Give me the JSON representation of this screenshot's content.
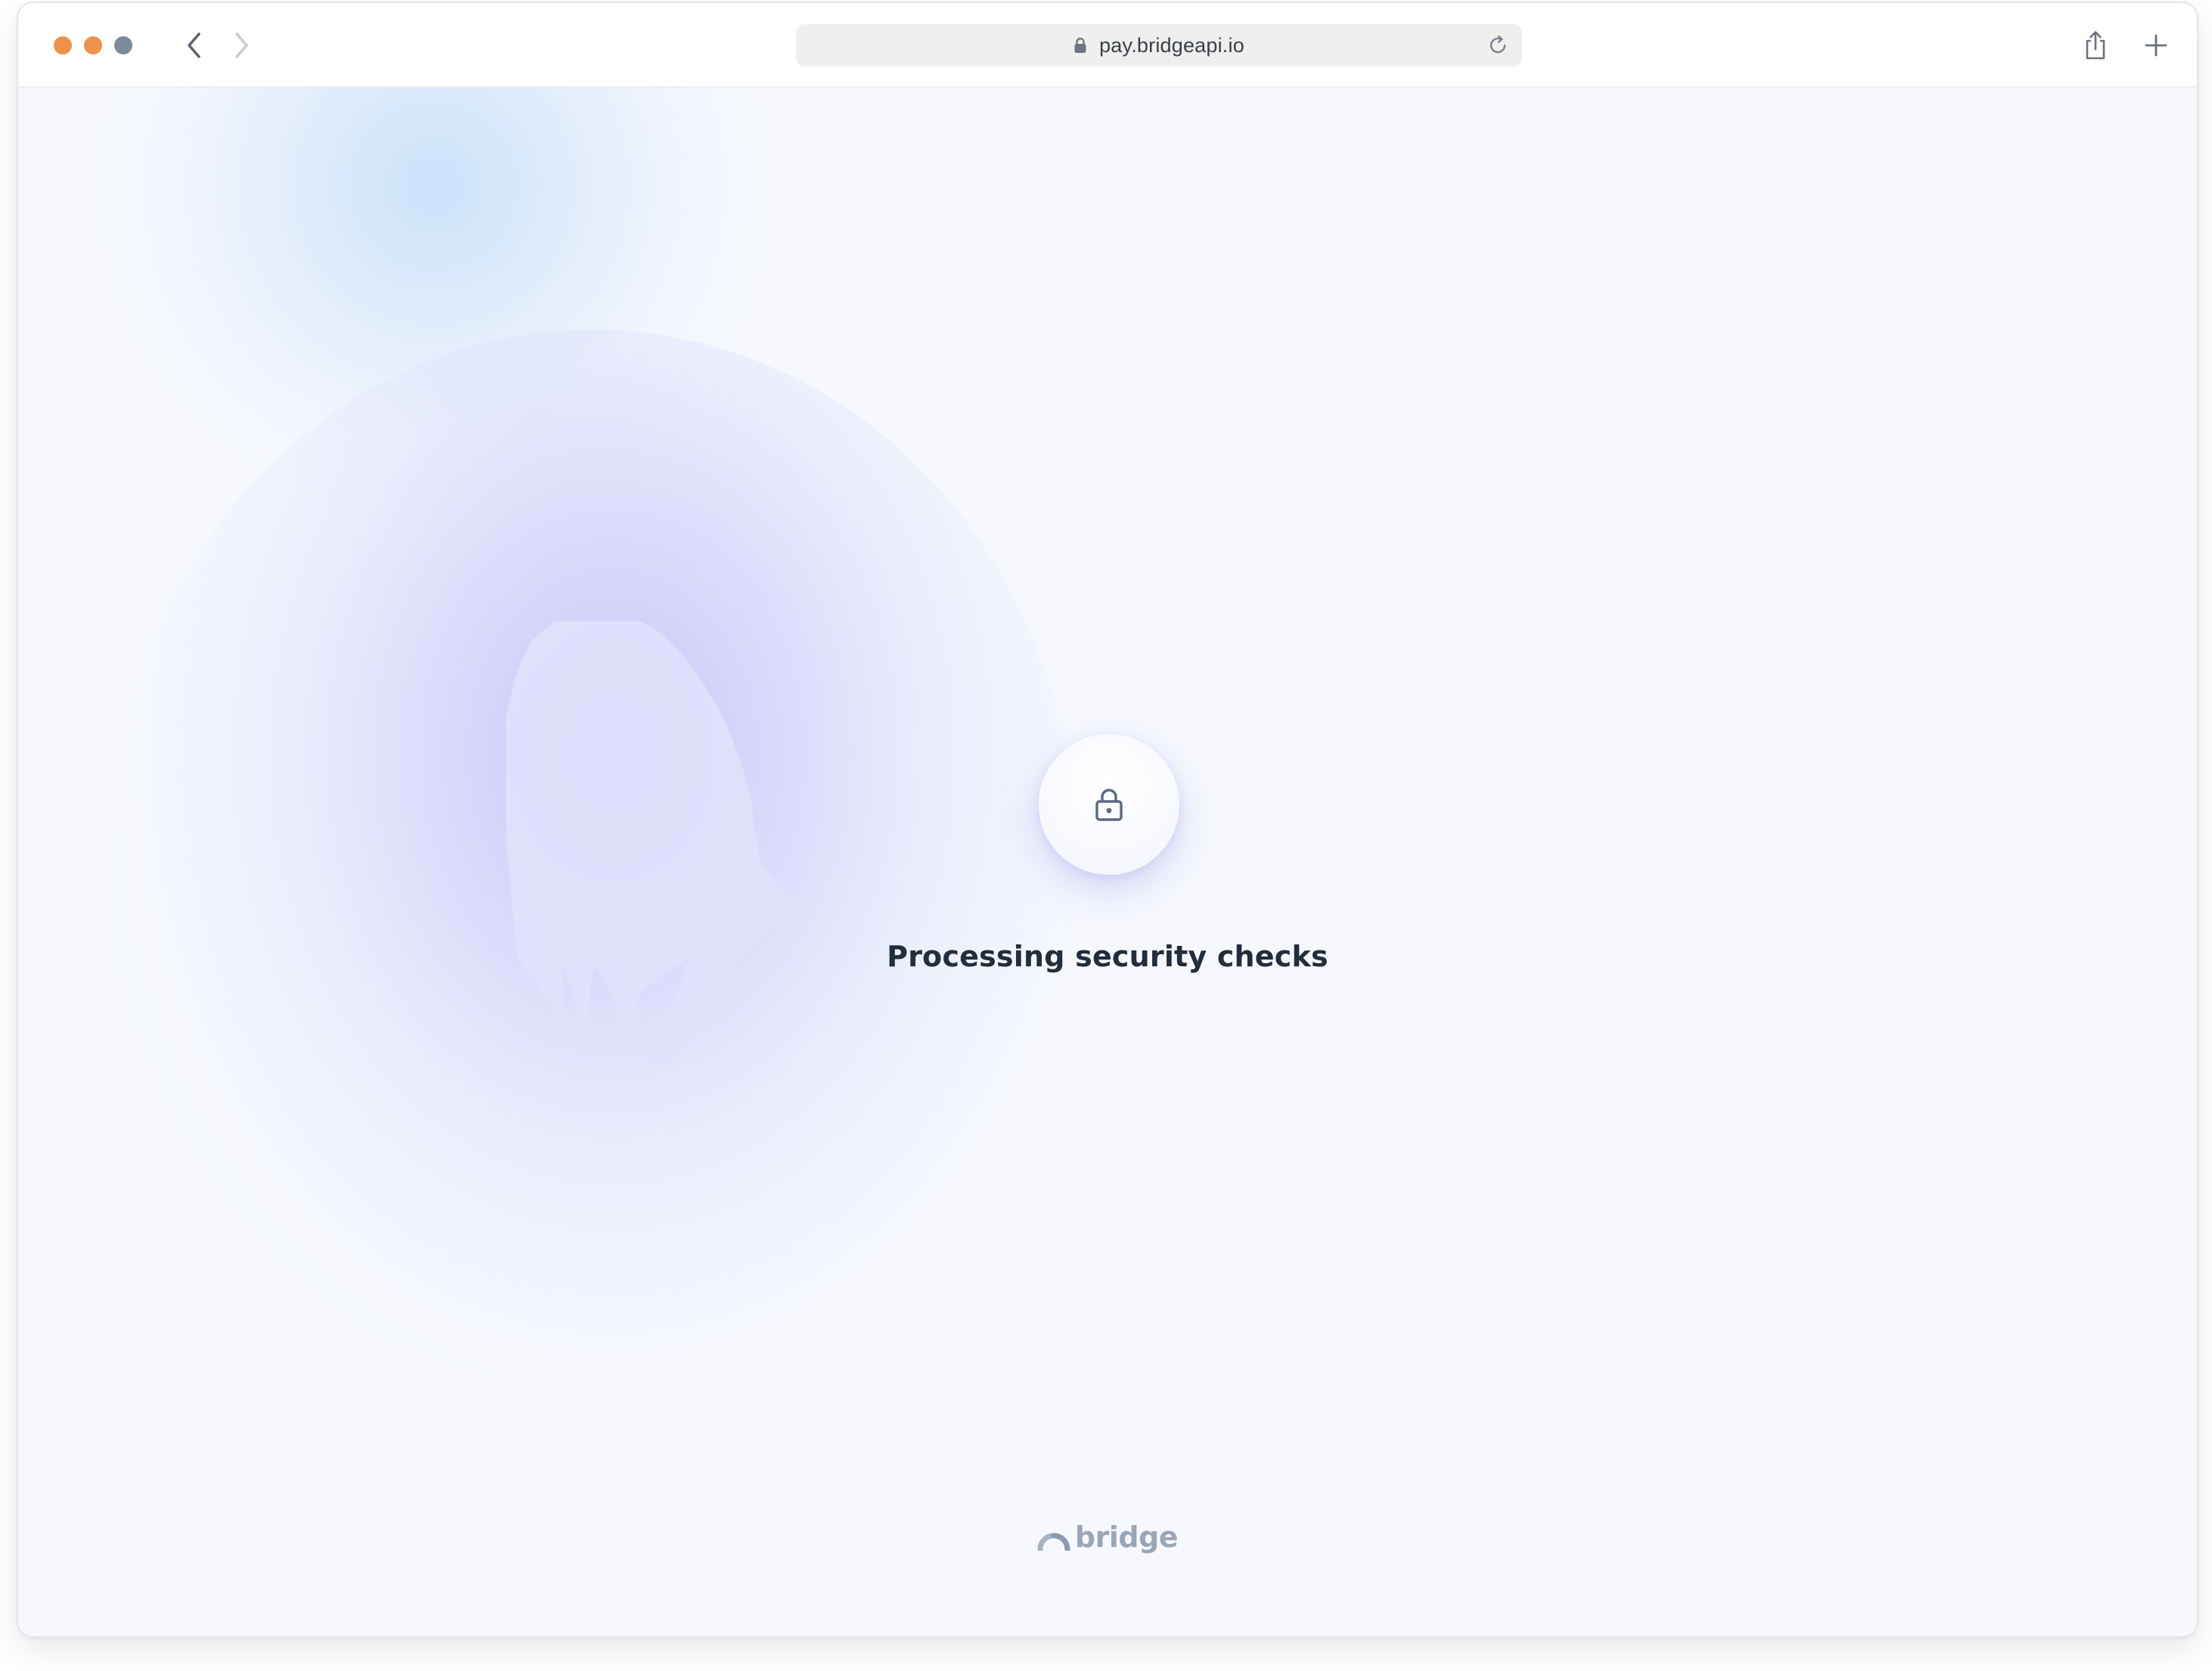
{
  "browser": {
    "url": "pay.bridgeapi.io",
    "icons": {
      "back": "chevron-left-icon",
      "forward": "chevron-right-icon",
      "lock": "lock-icon",
      "reload": "reload-icon",
      "share": "share-icon",
      "new_tab": "plus-icon"
    },
    "traffic_light_colors": [
      "#f0924b",
      "#f0924b",
      "#7d8a9c"
    ]
  },
  "page": {
    "status_icon": "lock-icon",
    "status_text": "Processing security checks",
    "brand_name": "bridge",
    "colors": {
      "background": "#f6f8fd",
      "text": "#222d3d",
      "brand": "#9aa6b8",
      "glow_purple": "#c4c4f7",
      "glow_blue": "#c8e1fa"
    }
  }
}
